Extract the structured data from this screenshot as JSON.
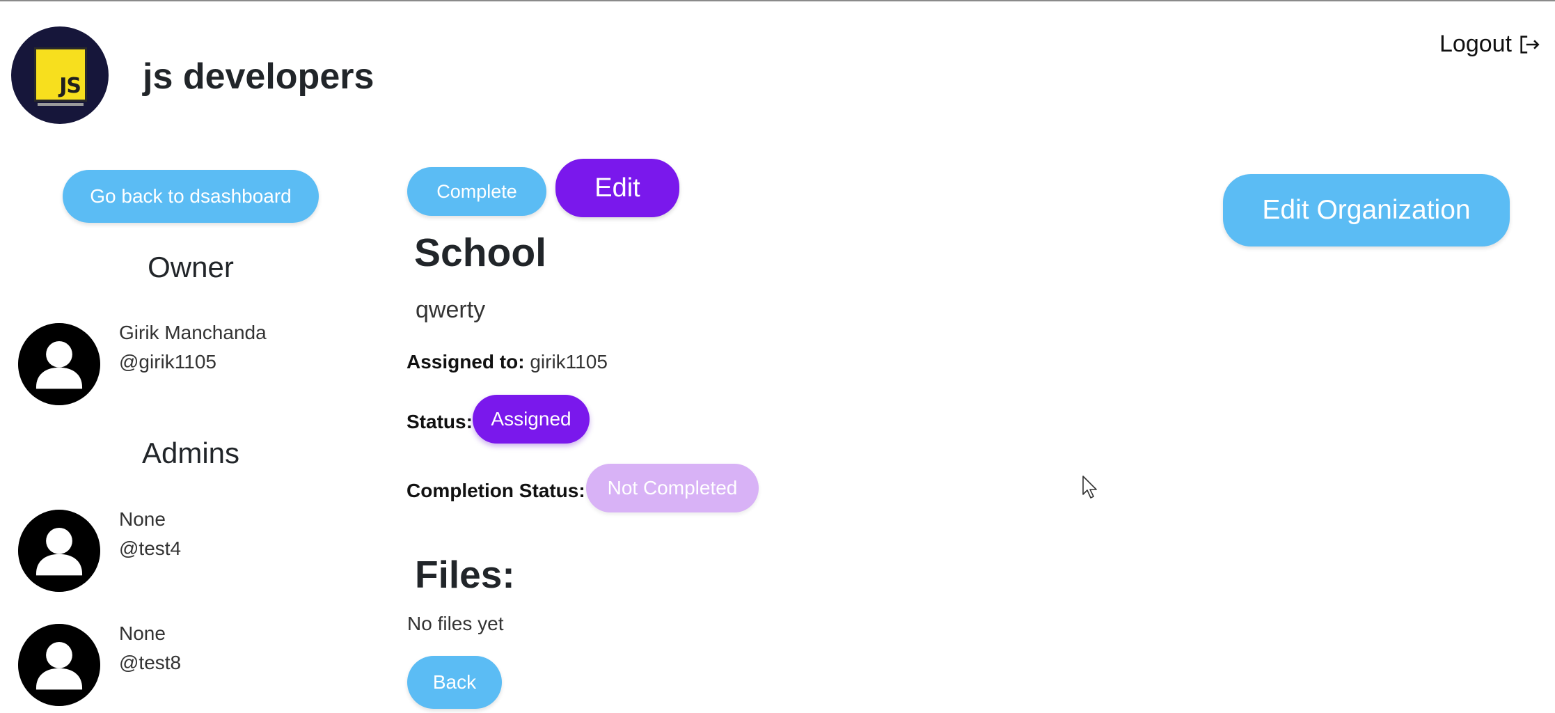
{
  "header": {
    "org_name": "js developers",
    "logo_text": "JS",
    "logout_label": "Logout"
  },
  "sidebar": {
    "back_button": "Go back to dsashboard",
    "owner_title": "Owner",
    "owner": {
      "name": "Girik Manchanda",
      "handle": "@girik1105"
    },
    "admins_title": "Admins",
    "admins": [
      {
        "name": "None",
        "handle": "@test4"
      },
      {
        "name": "None",
        "handle": "@test8"
      }
    ]
  },
  "task": {
    "complete_button": "Complete",
    "edit_button": "Edit",
    "title": "School",
    "description": "qwerty",
    "assigned_label": "Assigned to:",
    "assigned_value": "girik1105",
    "status_label": "Status:",
    "status_value": "Assigned",
    "completion_label": "Completion Status:",
    "completion_value": "Not Completed",
    "files_title": "Files:",
    "files_empty": "No files yet",
    "back_button": "Back"
  },
  "actions": {
    "edit_org_button": "Edit Organization"
  },
  "colors": {
    "primary_blue": "#5bbcf4",
    "primary_purple": "#7a18ec",
    "light_purple": "#d8b2f6"
  },
  "icons": {
    "logout": "logout-icon",
    "avatar": "user-avatar-icon",
    "cursor": "mouse-cursor-icon"
  }
}
